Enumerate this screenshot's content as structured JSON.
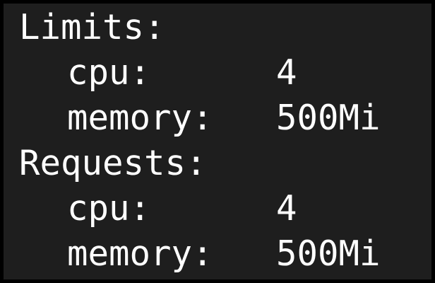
{
  "terminal": {
    "background": "#1e1e1e",
    "foreground": "#ffffff",
    "sections": [
      {
        "heading": "Limits:",
        "entries": [
          {
            "key": "cpu:",
            "value": "4"
          },
          {
            "key": "memory:",
            "value": "500Mi"
          }
        ]
      },
      {
        "heading": "Requests:",
        "entries": [
          {
            "key": "cpu:",
            "value": "4"
          },
          {
            "key": "memory:",
            "value": "500Mi"
          }
        ]
      }
    ]
  }
}
